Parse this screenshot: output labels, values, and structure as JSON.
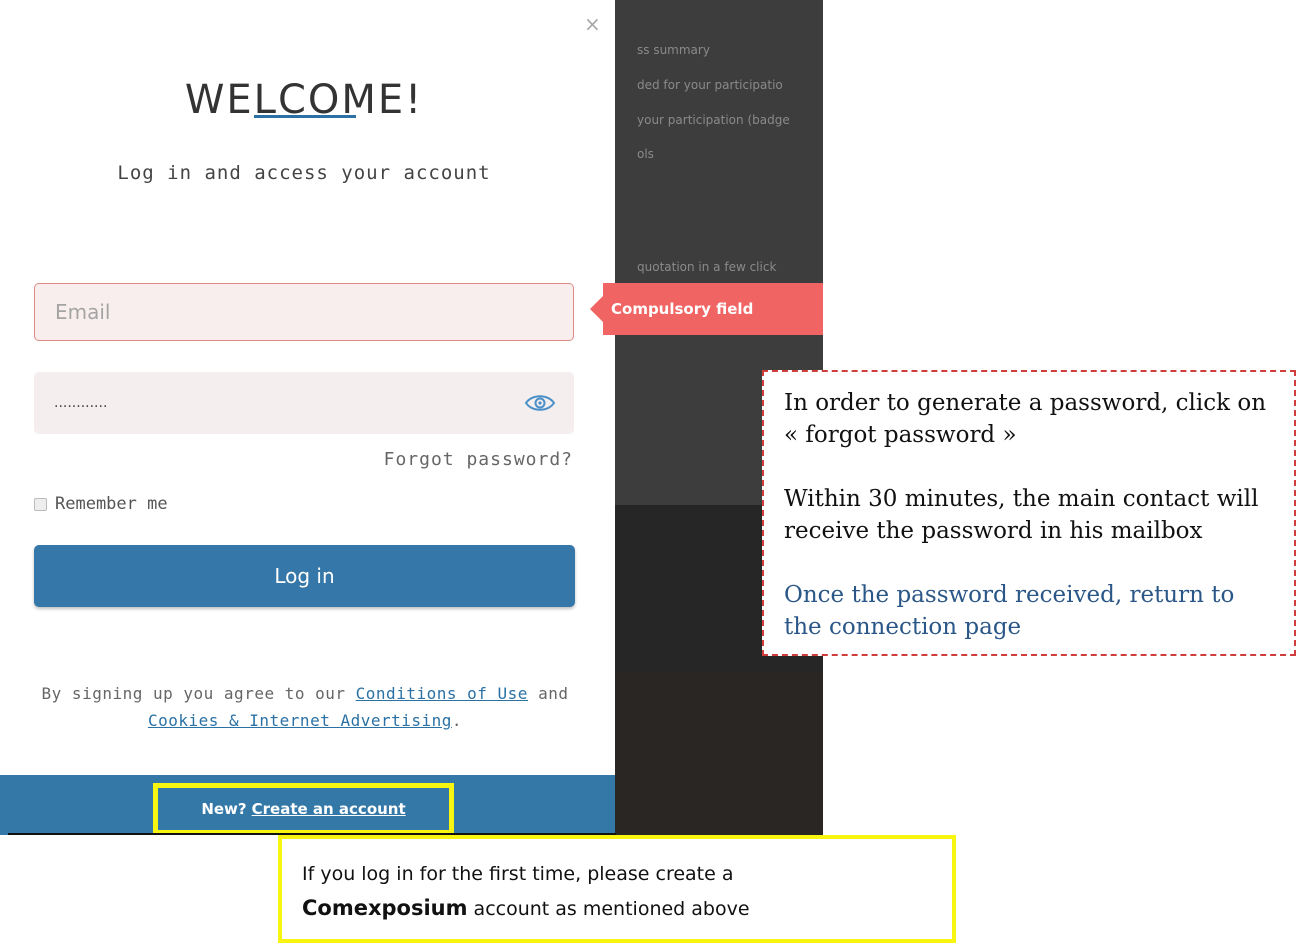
{
  "background": {
    "lines": [
      "ss summary",
      "ded for your participatio",
      "your participation (badge",
      "ols",
      "quotation in a few click"
    ]
  },
  "modal": {
    "close_label": "×",
    "title": "WELCOME!",
    "subtitle": "Log in and access your account",
    "email_placeholder": "Email",
    "password_value": "............",
    "password_toggle_icon": "eye-icon",
    "forgot_label": "Forgot password?",
    "remember_label": "Remember me",
    "login_label": "Log in",
    "legal": {
      "prefix": "By signing up you agree to our",
      "conditions_label": "Conditions of Use",
      "and": "and",
      "cookies_label": "Cookies & Internet Advertising",
      "suffix": "."
    },
    "footer": {
      "new_label": "New?",
      "create_label": "Create an account"
    }
  },
  "tooltip": {
    "text": "Compulsory field"
  },
  "annotations": {
    "password_note": {
      "line1": "In order to generate a password, click on « forgot password »",
      "line2": "Within 30 minutes, the main contact will receive the password in his mailbox",
      "line3": "Once the password received, return to the connection page"
    },
    "account_note": {
      "prefix": "If you log in for the first time, please create a",
      "brand": "Comexposium",
      "suffix": "account as mentioned above"
    }
  },
  "colors": {
    "accent_blue": "#3477a8",
    "error_red": "#f06463",
    "highlight_yellow": "#f8f511",
    "note_blue": "#2a5787"
  }
}
